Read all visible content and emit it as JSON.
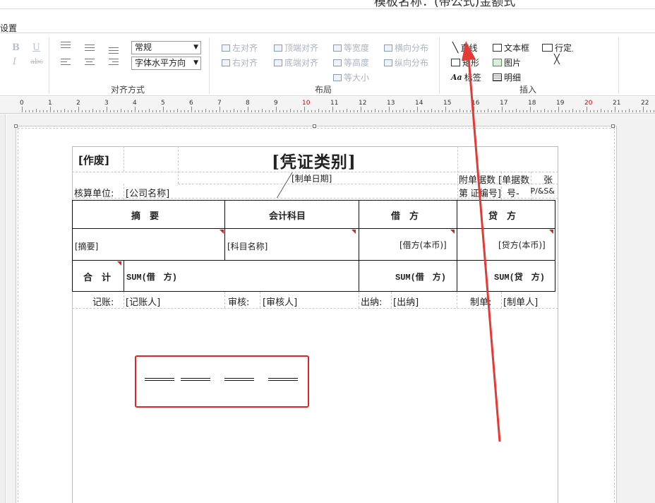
{
  "window": {
    "title": "模板名称：(带公式)金额式"
  },
  "tabs": {
    "settings": "设置"
  },
  "ribbon": {
    "font_size_select": "常规",
    "font_dir_select": "字体水平方向",
    "align_group_label": "对齐方式",
    "layout_group_label": "布局",
    "insert_group_label": "插入",
    "format_buttons": [
      "B",
      "U",
      "I",
      "abc"
    ],
    "layout_buttons": {
      "align_left": "左对齐",
      "align_top": "顶端对齐",
      "equal_width": "等宽度",
      "distribute_h": "横向分布",
      "align_right": "右对齐",
      "align_bottom": "底端对齐",
      "equal_height": "等高度",
      "distribute_v": "纵向分布",
      "equal_size": "等大小"
    },
    "insert_buttons": {
      "line": "直线",
      "textbox": "文本框",
      "row_fixed": "行定义",
      "rect": "矩形",
      "image": "图片",
      "label": "标签",
      "detail": "明细"
    }
  },
  "ruler": {
    "numbers": [
      "0",
      "1",
      "2",
      "3",
      "4",
      "5",
      "6",
      "7",
      "8",
      "9",
      "10",
      "11",
      "12",
      "13",
      "14",
      "15",
      "16",
      "17",
      "18",
      "19",
      "20",
      "21",
      "22"
    ]
  },
  "voucher": {
    "void": "[作废]",
    "title": "[凭证类别]",
    "date": "[制单日期]",
    "attach_label": "附单据数",
    "attach_value": "[单据数]",
    "attach_unit": "张",
    "unit_label": "核算单位:",
    "unit_value": "[公司名称]",
    "no_prefix": "第",
    "no_value": "[凭证编号]",
    "no_label": "号-",
    "page_fmt": "&P/&S",
    "headers": {
      "summary": "摘　要",
      "subject": "会计科目",
      "debit": "借　方",
      "credit": "贷　方"
    },
    "row": {
      "summary": "[摘要]",
      "subject": "[科目名称]",
      "debit": "[借方(本币)]",
      "credit": "[贷方(本币)]"
    },
    "total": {
      "label": "合　计",
      "summary": "SUM(借　方)",
      "debit": "SUM(借　方)",
      "credit": "SUM(贷　方)"
    },
    "footer": {
      "bookkeeper_label": "记账:",
      "bookkeeper": "[记账人]",
      "reviewer_label": "审核:",
      "reviewer": "[审核人]",
      "cashier_label": "出纳:",
      "cashier": "[出纳]",
      "maker_label": "制单:",
      "maker": "[制单人]"
    }
  },
  "colors": {
    "highlight": "#e02424",
    "arrow": "#e53935"
  }
}
